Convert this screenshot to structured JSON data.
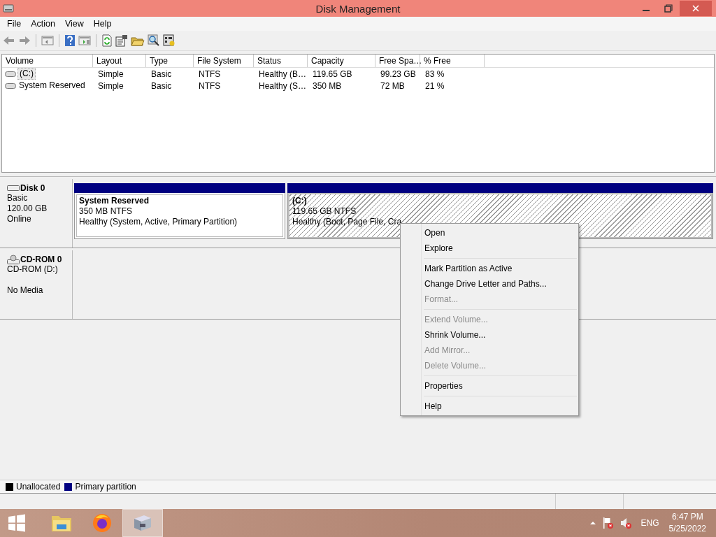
{
  "window": {
    "title": "Disk Management"
  },
  "menu": [
    "File",
    "Action",
    "View",
    "Help"
  ],
  "volumes": {
    "columns": [
      "Volume",
      "Layout",
      "Type",
      "File System",
      "Status",
      "Capacity",
      "Free Spa…",
      "% Free"
    ],
    "rows": [
      {
        "selected": true,
        "cells": [
          "(C:)",
          "Simple",
          "Basic",
          "NTFS",
          "Healthy (B…",
          "119.65 GB",
          "99.23 GB",
          "83 %"
        ]
      },
      {
        "selected": false,
        "cells": [
          "System Reserved",
          "Simple",
          "Basic",
          "NTFS",
          "Healthy (S…",
          "350 MB",
          "72 MB",
          "21 %"
        ]
      }
    ]
  },
  "disks": [
    {
      "kind": "disk",
      "name": "Disk 0",
      "lines": [
        "Basic",
        "120.00 GB",
        "Online"
      ],
      "partitions": [
        {
          "name": "System Reserved",
          "size": "350 MB NTFS",
          "status": "Healthy (System, Active, Primary Partition)",
          "selected": false
        },
        {
          "name": "(C:)",
          "size": "119.65 GB NTFS",
          "status": "Healthy (Boot, Page File, Cra",
          "selected": true
        }
      ]
    },
    {
      "kind": "cdrom",
      "name": "CD-ROM 0",
      "lines": [
        "CD-ROM (D:)",
        "No Media"
      ]
    }
  ],
  "context_menu": [
    {
      "kind": "item",
      "label": "Open",
      "disabled": false
    },
    {
      "kind": "item",
      "label": "Explore",
      "disabled": false
    },
    {
      "kind": "separator"
    },
    {
      "kind": "item",
      "label": "Mark Partition as Active",
      "disabled": false
    },
    {
      "kind": "item",
      "label": "Change Drive Letter and Paths...",
      "disabled": false
    },
    {
      "kind": "item",
      "label": "Format...",
      "disabled": true
    },
    {
      "kind": "separator"
    },
    {
      "kind": "item",
      "label": "Extend Volume...",
      "disabled": true
    },
    {
      "kind": "item",
      "label": "Shrink Volume...",
      "disabled": false
    },
    {
      "kind": "item",
      "label": "Add Mirror...",
      "disabled": true
    },
    {
      "kind": "item",
      "label": "Delete Volume...",
      "disabled": true
    },
    {
      "kind": "separator"
    },
    {
      "kind": "item",
      "label": "Properties",
      "disabled": false
    },
    {
      "kind": "separator"
    },
    {
      "kind": "item",
      "label": "Help",
      "disabled": false
    }
  ],
  "legend": [
    {
      "label": "Unallocated",
      "color": "#000000"
    },
    {
      "label": "Primary partition",
      "color": "#000080"
    }
  ],
  "taskbar": {
    "apps": [
      {
        "kind": "folder",
        "selected": false
      },
      {
        "kind": "browser",
        "selected": false
      },
      {
        "kind": "diskmgmt",
        "selected": true
      }
    ],
    "language": "ENG",
    "time": "6:47 PM",
    "date": "5/25/2022"
  }
}
